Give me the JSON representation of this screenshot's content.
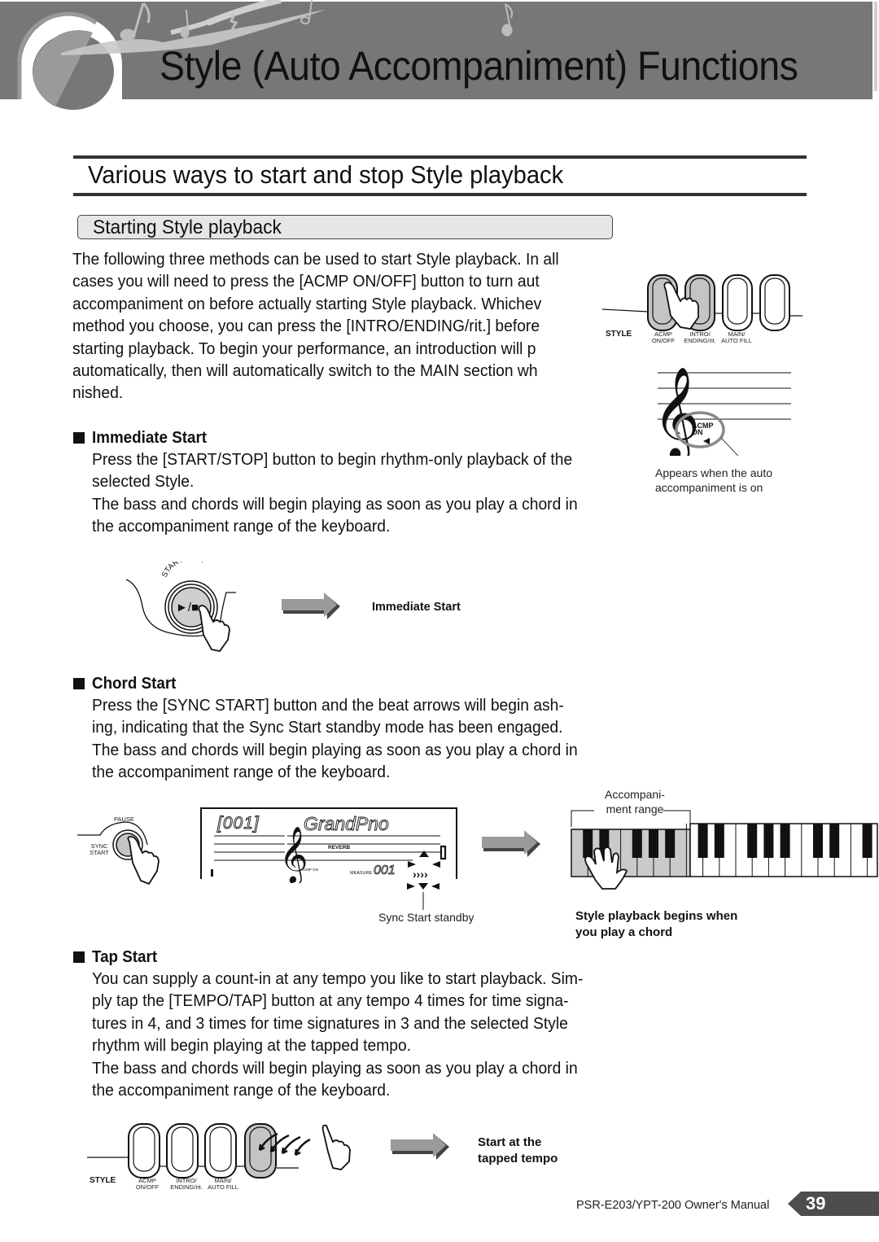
{
  "header": {
    "title": "Style (Auto Accompaniment) Functions"
  },
  "section": {
    "title": "Various ways to start and stop Style playback",
    "subsection_title": "Starting Style playback"
  },
  "intro": {
    "lines": [
      "The following three methods can be used to start Style playback. In all",
      "cases you will need to press the [ACMP ON/OFF] button to turn aut",
      "accompaniment on before actually starting Style playback. Whichev",
      "method you choose, you can press the [INTRO/ENDING/rit.] before",
      "starting playback. To begin your performance, an introduction will p",
      "automatically, then will automatically switch to the MAIN section wh",
      " nished."
    ]
  },
  "panel_diagram": {
    "style_label": "STYLE",
    "buttons": [
      {
        "label": "ACMP\nON/OFF",
        "pressed": true
      },
      {
        "label": "INTRO/\nENDING/rit.",
        "pressed": true
      },
      {
        "label": "MAIN/\nAUTO FILL",
        "pressed": false
      },
      {
        "label": "",
        "pressed": false
      }
    ],
    "button_labels": [
      "ACMP",
      "ON/OFF",
      "INTRO/",
      "ENDING/rit.",
      "MAIN/",
      "AUTO FILL"
    ],
    "acmp_indicator": "ACMP",
    "acmp_indicator_2": "ON",
    "caption_line1": "Appears when the auto",
    "caption_line2": "accompaniment is on"
  },
  "immediate_start": {
    "heading": "Immediate Start",
    "lines": [
      "Press the [START/STOP] button to begin rhythm-only playback of the",
      "selected Style.",
      "The bass and chords will begin playing as soon as you play a chord in",
      "the accompaniment range of the keyboard."
    ],
    "button_label": "START/STOP",
    "button_symbol": "►/■",
    "result_label": "Immediate Start"
  },
  "chord_start": {
    "heading": "Chord Start",
    "lines": [
      "Press the [SYNC START] button and the beat arrows will begin  ash-",
      "ing, indicating that the Sync Start  standby  mode has been engaged.",
      "The bass and chords will begin playing as soon as you play a chord in",
      "the accompaniment range of the keyboard."
    ],
    "pause_label": "PAUSE",
    "sync_label_1": "SYNC",
    "sync_label_2": "START",
    "lcd": {
      "number": "[001]",
      "voice_name": "GrandPno",
      "reverb": "REVERB",
      "measure_label": "MEASURE",
      "measure_value": "001",
      "acmp_on": "ACMP ON"
    },
    "standby_caption": "Sync Start standby",
    "range_caption_1": "Accompani-",
    "range_caption_2": "ment range",
    "result_line1": "Style playback begins when",
    "result_line2": "you play a chord"
  },
  "tap_start": {
    "heading": "Tap Start",
    "lines": [
      "You can supply a count-in at any tempo you like to start playback. Sim-",
      "ply tap the [TEMPO/TAP] button at any tempo 4 times for time signa-",
      "tures in 4, and 3 times for time signatures in 3 and the selected Style",
      "rhythm will begin playing at the tapped tempo.",
      "The bass and chords will begin playing as soon as you play a chord in",
      "the accompaniment range of the keyboard."
    ],
    "style_label": "STYLE",
    "button_labels": [
      "ACMP",
      "ON/OFF",
      "INTRO/",
      "ENDING/rit.",
      "MAIN/",
      "AUTO FILL"
    ],
    "result_line1": "Start at the",
    "result_line2": "tapped tempo"
  },
  "footer": {
    "manual_name": "PSR-E203/YPT-200   Owner's Manual",
    "page_number": "39"
  },
  "colors": {
    "banner_gray": "#777777",
    "pressed_button": "#c8c8c8",
    "arrow_gray": "#999999"
  }
}
